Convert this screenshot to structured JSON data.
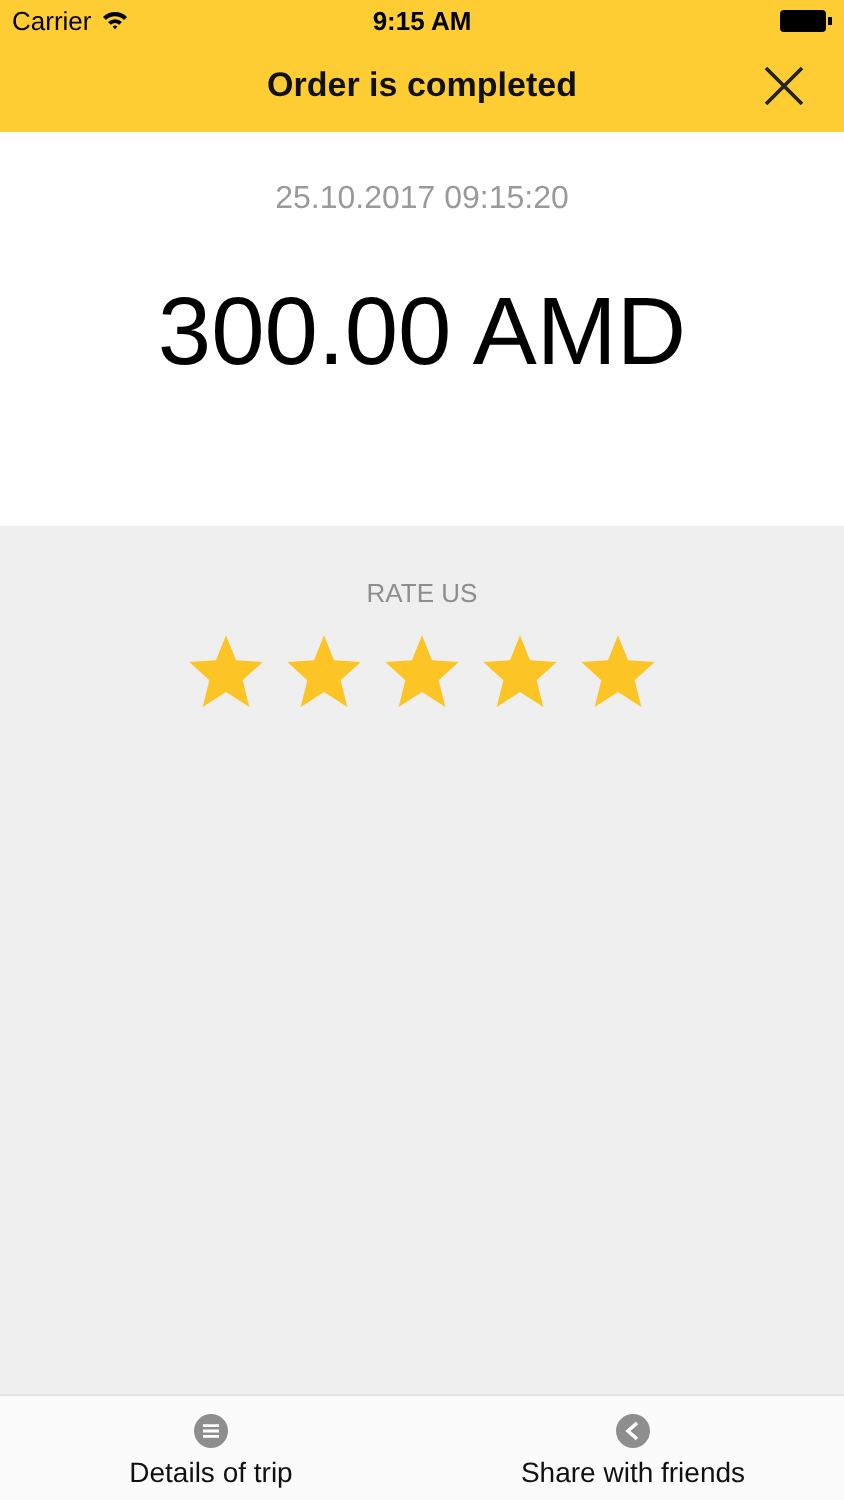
{
  "status_bar": {
    "carrier": "Carrier",
    "time": "9:15 AM"
  },
  "header": {
    "title": "Order is completed"
  },
  "order": {
    "datetime": "25.10.2017 09:15:20",
    "amount": "300.00 AMD"
  },
  "rating": {
    "label": "RATE US",
    "stars": 5
  },
  "bottom_bar": [
    {
      "kind": "list",
      "label": "Details of trip"
    },
    {
      "kind": "share",
      "label": "Share with friends"
    }
  ]
}
